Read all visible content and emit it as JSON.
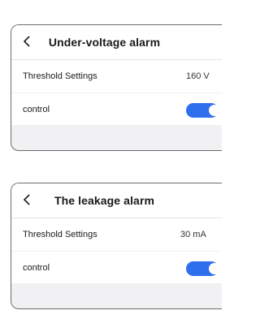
{
  "panels": [
    {
      "title": "Under-voltage alarm",
      "threshold_label": "Threshold Settings",
      "threshold_value": "160 V",
      "control_label": "control",
      "control_on": true
    },
    {
      "title": "The leakage alarm",
      "threshold_label": "Threshold Settings",
      "threshold_value": "30 mA",
      "control_label": "control",
      "control_on": true
    }
  ],
  "colors": {
    "accent": "#2f6fed",
    "background": "#f1f1f3",
    "border": "#6b6b6b"
  },
  "icons": {
    "back": "chevron-left-icon"
  }
}
